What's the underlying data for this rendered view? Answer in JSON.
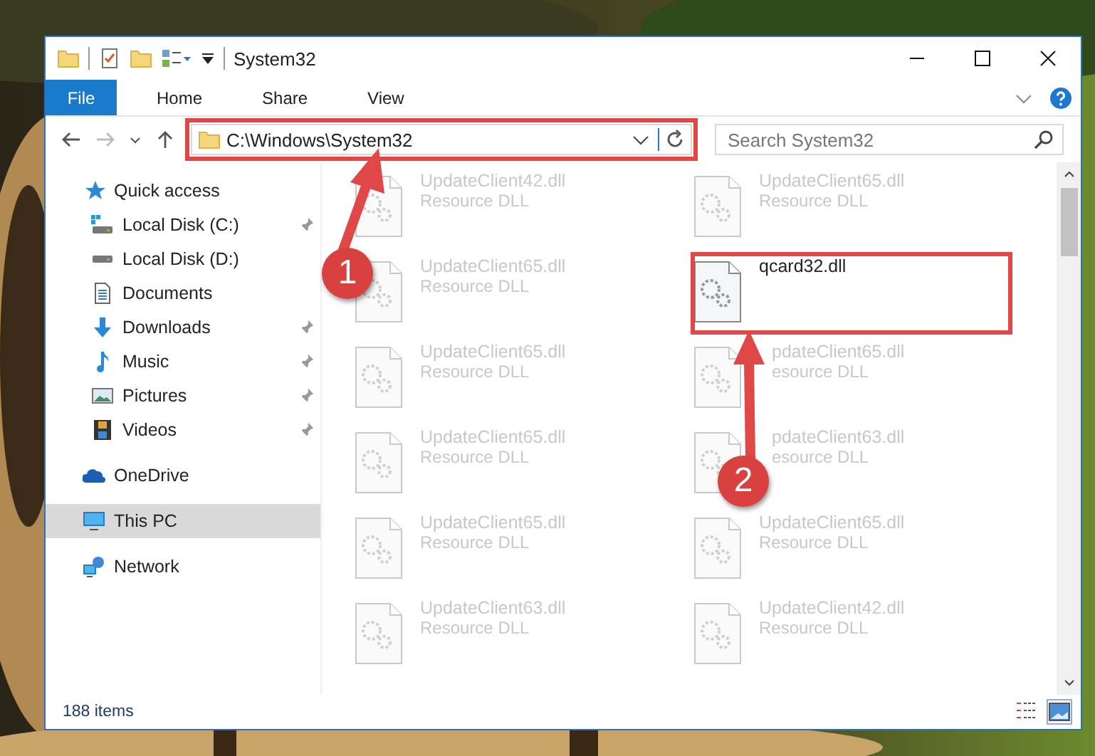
{
  "window": {
    "title": "System32"
  },
  "ribbon": {
    "tabs": [
      {
        "label": "File",
        "selected": true
      },
      {
        "label": "Home",
        "selected": false
      },
      {
        "label": "Share",
        "selected": false
      },
      {
        "label": "View",
        "selected": false
      }
    ]
  },
  "address": {
    "path": "C:\\Windows\\System32",
    "highlighted": true
  },
  "search": {
    "placeholder": "Search System32"
  },
  "sidebar": {
    "items": [
      {
        "label": "Quick access",
        "kind": "star",
        "pinned": false,
        "selected": false,
        "children": [
          {
            "label": "Local Disk (C:)",
            "kind": "drivec",
            "pinned": true,
            "selected": false
          },
          {
            "label": "Local Disk (D:)",
            "kind": "drive",
            "pinned": false,
            "selected": false
          },
          {
            "label": "Documents",
            "kind": "documents",
            "pinned": false,
            "selected": false
          },
          {
            "label": "Downloads",
            "kind": "downloads",
            "pinned": true,
            "selected": false
          },
          {
            "label": "Music",
            "kind": "music",
            "pinned": true,
            "selected": false
          },
          {
            "label": "Pictures",
            "kind": "pictures",
            "pinned": true,
            "selected": false
          },
          {
            "label": "Videos",
            "kind": "videos",
            "pinned": true,
            "selected": false
          }
        ]
      },
      {
        "label": "OneDrive",
        "kind": "cloud",
        "pinned": false,
        "selected": false
      },
      {
        "label": "This PC",
        "kind": "pc",
        "pinned": false,
        "selected": true
      },
      {
        "label": "Network",
        "kind": "network",
        "pinned": false,
        "selected": false
      }
    ]
  },
  "files": [
    {
      "name": "UpdateClient42.dll",
      "type": "Resource DLL",
      "blurred": true
    },
    {
      "name": "UpdateClient65.dll",
      "type": "Resource DLL",
      "blurred": true
    },
    {
      "name": "UpdateClient65.dll",
      "type": "Resource DLL",
      "blurred": true
    },
    {
      "name": "qcard32.dll",
      "blurred": false,
      "highlighted": true
    },
    {
      "name": "UpdateClient65.dll",
      "type": "Resource DLL",
      "blurred": true
    },
    {
      "name": "pdateClient65.dll",
      "type": "esource DLL",
      "blurred": true,
      "cut": true
    },
    {
      "name": "UpdateClient65.dll",
      "type": "Resource DLL",
      "blurred": true
    },
    {
      "name": "pdateClient63.dll",
      "type": "esource DLL",
      "blurred": true,
      "cut": true
    },
    {
      "name": "UpdateClient65.dll",
      "type": "Resource DLL",
      "blurred": true
    },
    {
      "name": "UpdateClient65.dll",
      "type": "Resource DLL",
      "blurred": true
    },
    {
      "name": "UpdateClient63.dll",
      "type": "Resource DLL",
      "blurred": true
    },
    {
      "name": "UpdateClient42.dll",
      "type": "Resource DLL",
      "blurred": true
    }
  ],
  "annotations": [
    {
      "number": "1"
    },
    {
      "number": "2"
    }
  ],
  "status_bar": {
    "count": "188 items"
  }
}
